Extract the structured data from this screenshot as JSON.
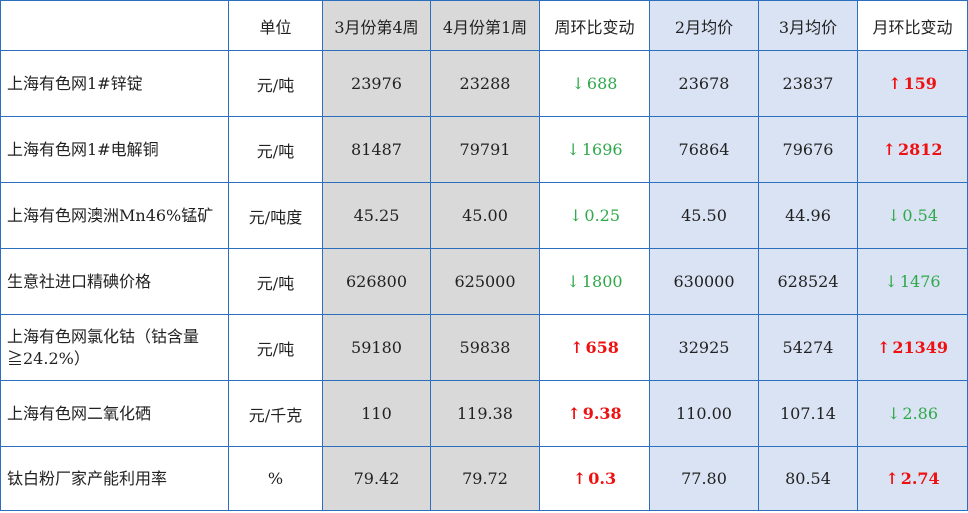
{
  "header": {
    "name": "",
    "unit": "单位",
    "prev_week": "3月份第4周",
    "cur_week": "4月份第1周",
    "week_change": "周环比变动",
    "feb_avg": "2月均价",
    "mar_avg": "3月均价",
    "month_change": "月环比变动"
  },
  "rows": [
    {
      "name": "上海有色网1#锌锭",
      "unit": "元/吨",
      "prev_week": "23976",
      "cur_week": "23288",
      "week_arrow": "↓",
      "week_change": "688",
      "week_dir": "down",
      "feb_avg": "23678",
      "mar_avg": "23837",
      "month_arrow": "↑",
      "month_change": "159",
      "month_dir": "up"
    },
    {
      "name": "上海有色网1#电解铜",
      "unit": "元/吨",
      "prev_week": "81487",
      "cur_week": "79791",
      "week_arrow": "↓",
      "week_change": "1696",
      "week_dir": "down",
      "feb_avg": "76864",
      "mar_avg": "79676",
      "month_arrow": "↑",
      "month_change": "2812",
      "month_dir": "up"
    },
    {
      "name": "上海有色网澳洲Mn46%锰矿",
      "unit": "元/吨度",
      "prev_week": "45.25",
      "cur_week": "45.00",
      "week_arrow": "↓",
      "week_change": "0.25",
      "week_dir": "down",
      "feb_avg": "45.50",
      "mar_avg": "44.96",
      "month_arrow": "↓",
      "month_change": "0.54",
      "month_dir": "down"
    },
    {
      "name": "生意社进口精碘价格",
      "unit": "元/吨",
      "prev_week": "626800",
      "cur_week": "625000",
      "week_arrow": "↓",
      "week_change": "1800",
      "week_dir": "down",
      "feb_avg": "630000",
      "mar_avg": "628524",
      "month_arrow": "↓",
      "month_change": "1476",
      "month_dir": "down"
    },
    {
      "name": "上海有色网氯化钴（钴含量≧24.2%）",
      "unit": "元/吨",
      "prev_week": "59180",
      "cur_week": "59838",
      "week_arrow": "↑",
      "week_change": "658",
      "week_dir": "up",
      "feb_avg": "32925",
      "mar_avg": "54274",
      "month_arrow": "↑",
      "month_change": "21349",
      "month_dir": "up"
    },
    {
      "name": "上海有色网二氧化硒",
      "unit": "元/千克",
      "prev_week": "110",
      "cur_week": "119.38",
      "week_arrow": "↑",
      "week_change": "9.38",
      "week_dir": "up",
      "feb_avg": "110.00",
      "mar_avg": "107.14",
      "month_arrow": "↓",
      "month_change": "2.86",
      "month_dir": "down"
    },
    {
      "name": "钛白粉厂家产能利用率",
      "unit": "%",
      "prev_week": "79.42",
      "cur_week": "79.72",
      "week_arrow": "↑",
      "week_change": "0.3",
      "week_dir": "up",
      "feb_avg": "77.80",
      "mar_avg": "80.54",
      "month_arrow": "↑",
      "month_change": "2.74",
      "month_dir": "up"
    }
  ],
  "colors": {
    "border": "#2b6fbe",
    "week_bg": "#d9d9d9",
    "month_bg": "#dae3f3",
    "down": "#2ea84a",
    "up": "#ee1111"
  }
}
